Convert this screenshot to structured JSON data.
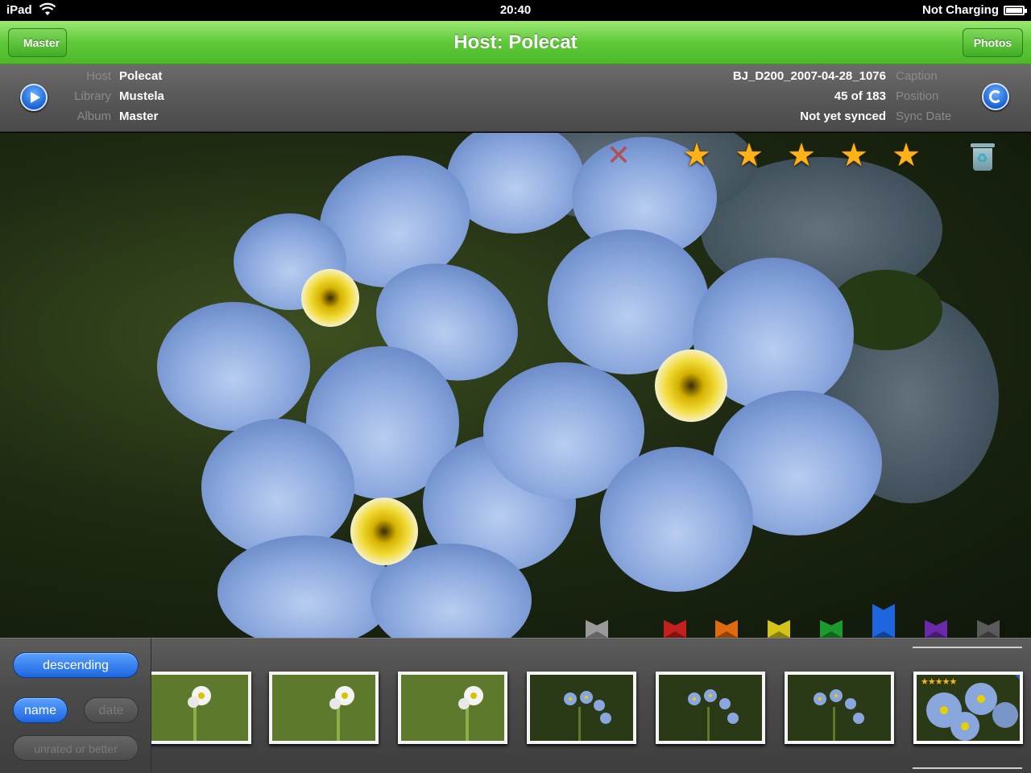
{
  "status_bar": {
    "device": "iPad",
    "time": "20:40",
    "charging": "Not Charging",
    "icons": [
      "wifi-icon",
      "battery-icon"
    ]
  },
  "nav": {
    "back_label": "Master",
    "title": "Host: Polecat",
    "right_label": "Photos"
  },
  "info": {
    "host_label": "Host",
    "host_value": "Polecat",
    "library_label": "Library",
    "library_value": "Mustela",
    "album_label": "Album",
    "album_value": "Master",
    "caption_label": "Caption",
    "caption_value": "BJ_D200_2007-04-28_1076",
    "position_label": "Position",
    "position_value": "45 of 183",
    "sync_label": "Sync Date",
    "sync_value": "Not yet synced",
    "icons": [
      "play-icon",
      "sync-icon"
    ]
  },
  "rating": {
    "stars": 5,
    "icons": [
      "reject-icon",
      "star-icon",
      "trash-icon"
    ]
  },
  "flags": {
    "colors": [
      "#9a9a9a",
      "#c42020",
      "#e06a10",
      "#d4c41a",
      "#1d9a2e",
      "#1e66e0",
      "#6a2aa8",
      "#5a5a5a"
    ],
    "selected_index": 5
  },
  "sort": {
    "order_label": "descending",
    "name_label": "name",
    "date_label": "date",
    "filter_label": "unrated or better"
  },
  "thumbnails": {
    "count": 7,
    "active_index": 6,
    "active_stars": "★★★★★",
    "star_color": "#ffb319"
  }
}
